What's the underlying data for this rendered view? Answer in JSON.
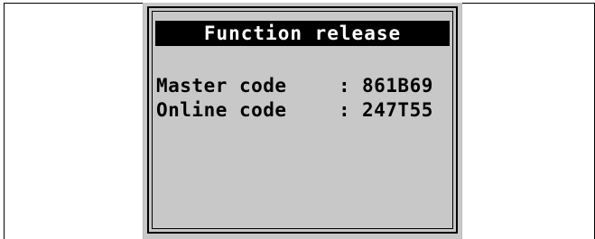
{
  "screen": {
    "title": "Function release",
    "rows": [
      {
        "label": "Master code",
        "separator": ":",
        "value": "861B69"
      },
      {
        "label": "Online code",
        "separator": ":",
        "value": "247T55"
      }
    ]
  },
  "colors": {
    "lcd_background": "#c8c8c8",
    "title_background": "#000000",
    "title_text": "#ffffff",
    "text": "#000000"
  }
}
